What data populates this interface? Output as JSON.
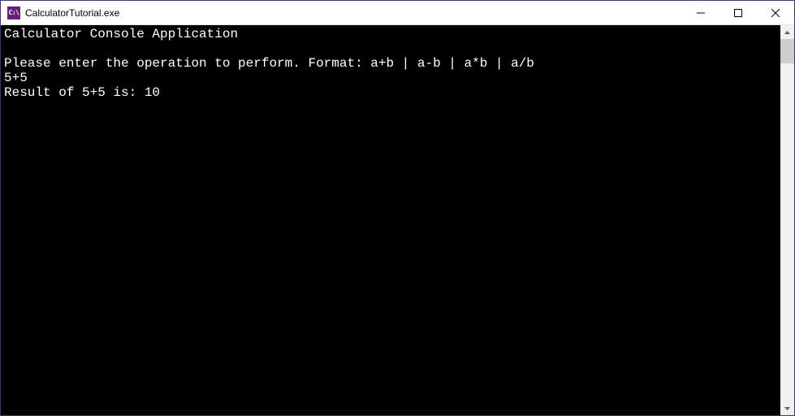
{
  "window": {
    "title": "CalculatorTutorial.exe",
    "icon_label": "C:\\"
  },
  "console": {
    "lines": [
      "Calculator Console Application",
      "",
      "Please enter the operation to perform. Format: a+b | a-b | a*b | a/b",
      "5+5",
      "Result of 5+5 is: 10"
    ]
  }
}
